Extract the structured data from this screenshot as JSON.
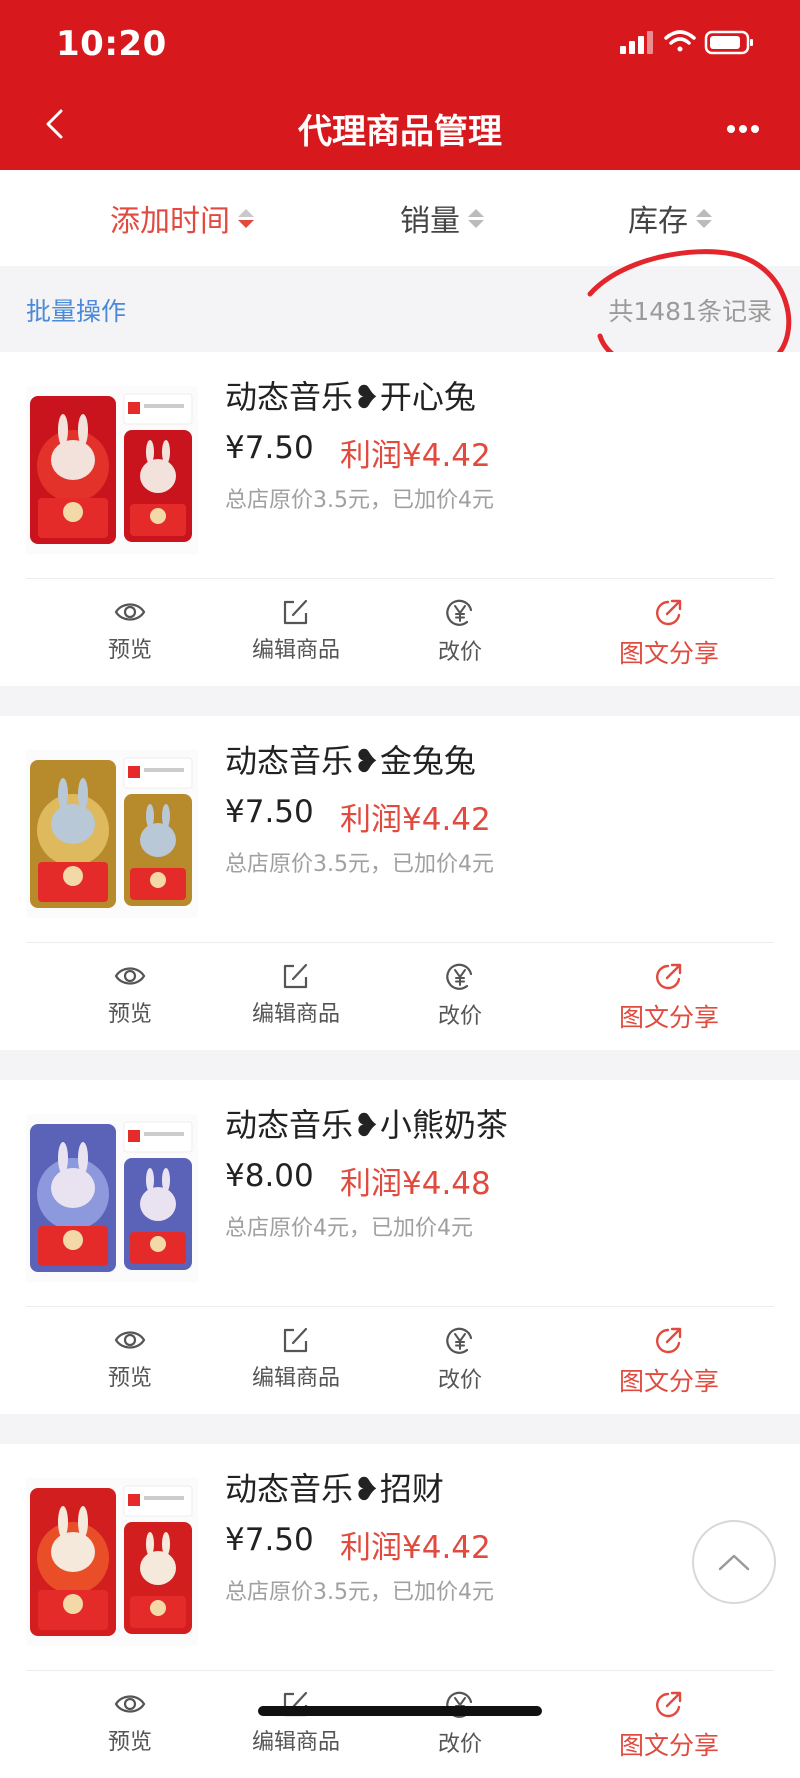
{
  "status": {
    "time": "10:20"
  },
  "header": {
    "title": "代理商品管理"
  },
  "sort": {
    "added_time": "添加时间",
    "sales": "销量",
    "stock": "库存"
  },
  "batch": {
    "label": "批量操作",
    "count": "共1481条记录"
  },
  "colors": {
    "brand": "#d7191d",
    "accent": "#e14b3f",
    "link": "#4a8ad8"
  },
  "actions": {
    "preview": "预览",
    "edit": "编辑商品",
    "reprice": "改价",
    "share": "图文分享"
  },
  "products": [
    {
      "name": "动态音乐❥开心兔",
      "price": "¥7.50",
      "profit": "利润¥4.42",
      "note": "总店原价3.5元，已加价4元"
    },
    {
      "name": "动态音乐❥金兔兔",
      "price": "¥7.50",
      "profit": "利润¥4.42",
      "note": "总店原价3.5元，已加价4元"
    },
    {
      "name": "动态音乐❥小熊奶茶",
      "price": "¥8.00",
      "profit": "利润¥4.48",
      "note": "总店原价4元，已加价4元"
    },
    {
      "name": "动态音乐❥招财",
      "price": "¥7.50",
      "profit": "利润¥4.42",
      "note": "总店原价3.5元，已加价4元"
    }
  ]
}
